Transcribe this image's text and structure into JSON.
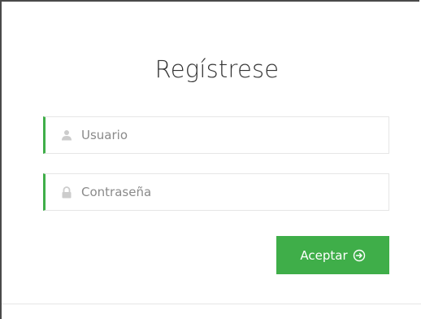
{
  "login": {
    "title": "Regístrese",
    "username": {
      "placeholder": "Usuario",
      "value": "",
      "icon": "user-icon"
    },
    "password": {
      "placeholder": "Contraseña",
      "value": "",
      "icon": "lock-icon"
    },
    "submit": {
      "label": "Aceptar",
      "icon": "arrow-circle-right-icon"
    }
  },
  "colors": {
    "accent": "#3fae49",
    "border": "#e6e6e6",
    "window_border": "#4a4a4a",
    "text": "#333333",
    "placeholder": "#8a8a8a",
    "icon": "#cccccc"
  }
}
